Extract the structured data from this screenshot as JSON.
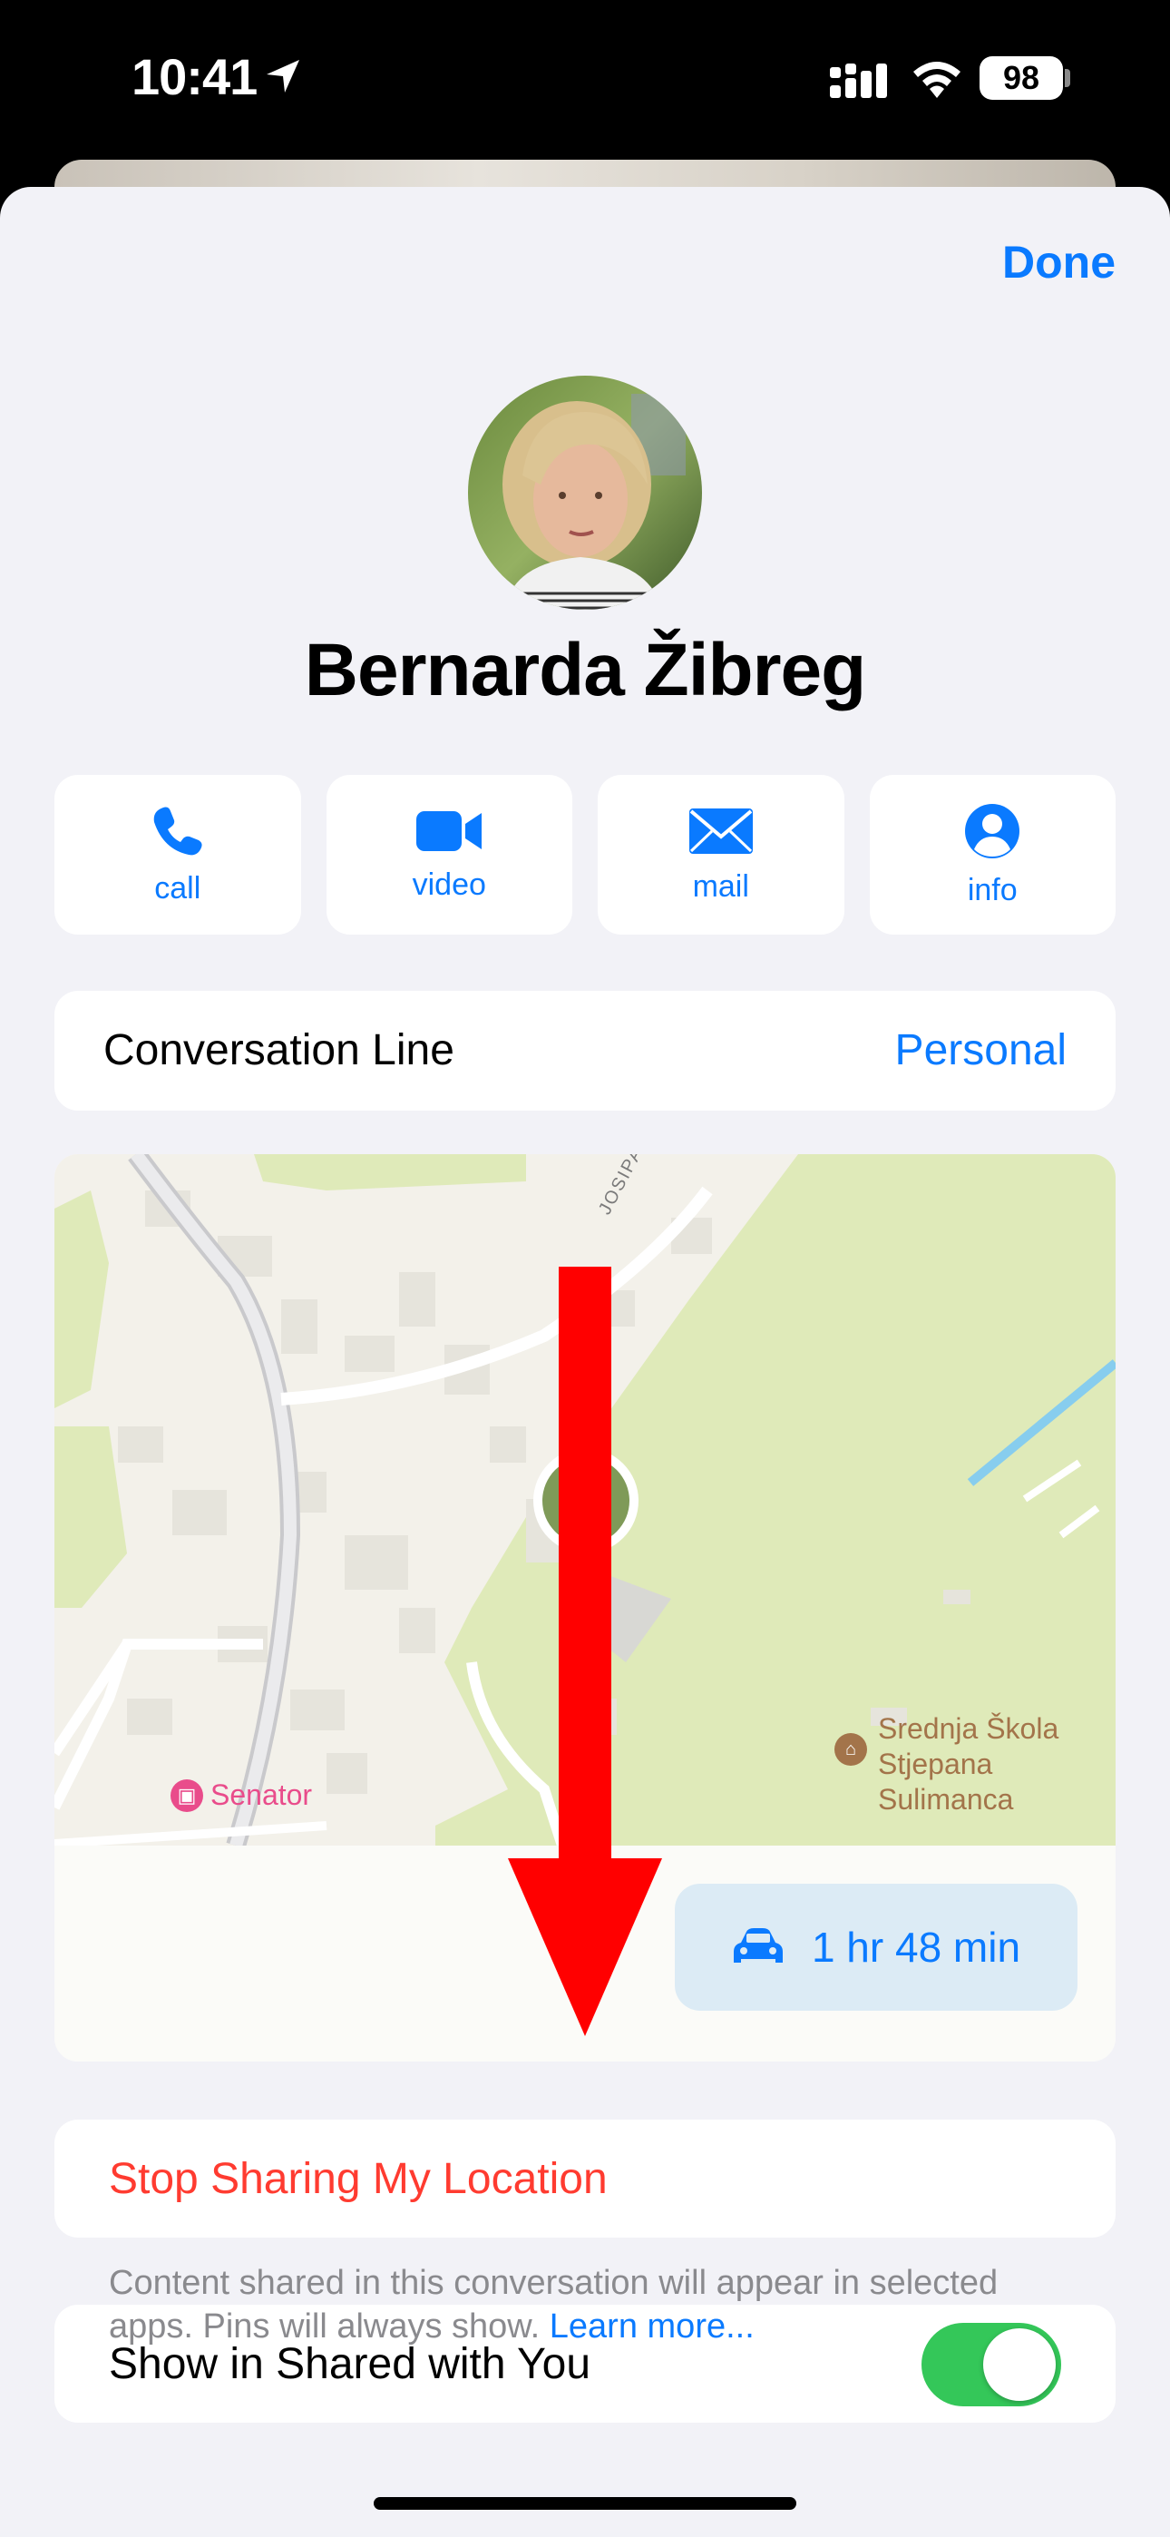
{
  "status_bar": {
    "time": "10:41",
    "battery": "98"
  },
  "header": {
    "done_label": "Done"
  },
  "contact": {
    "name": "Bernarda Žibreg"
  },
  "actions": [
    {
      "label": "call",
      "icon": "phone-icon"
    },
    {
      "label": "video",
      "icon": "video-camera-icon"
    },
    {
      "label": "mail",
      "icon": "envelope-icon"
    },
    {
      "label": "info",
      "icon": "person-circle-icon"
    }
  ],
  "conversation_line": {
    "label": "Conversation Line",
    "value": "Personal"
  },
  "map": {
    "street_label": "JOSIPA JU",
    "poi_senator": "Senator",
    "poi_school_line1": "Srednja Škola",
    "poi_school_line2": "Stjepana",
    "poi_school_line3": "Sulimanca",
    "eta": "1 hr 48 min"
  },
  "stop_sharing": {
    "label": "Stop Sharing My Location"
  },
  "shared_with_you": {
    "label": "Show in Shared with You",
    "enabled": true
  },
  "footnote": {
    "text": "Content shared in this conversation will appear in selected apps. Pins will always show.",
    "link": "Learn more..."
  },
  "colors": {
    "accent": "#0a7aff",
    "destructive": "#ff3b30",
    "toggle_on": "#34c759",
    "park_green": "#dfeab9",
    "annotation_red": "#ff0000"
  }
}
